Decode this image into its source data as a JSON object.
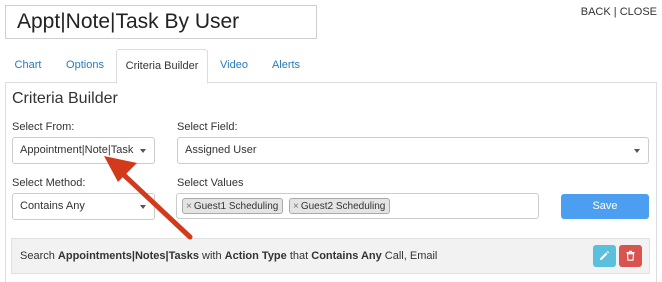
{
  "report_title": "Appt|Note|Task By User",
  "top_links": {
    "back": "BACK",
    "sep": " | ",
    "close": "CLOSE"
  },
  "tabs": [
    {
      "label": "Chart",
      "active": false
    },
    {
      "label": "Options",
      "active": false
    },
    {
      "label": "Criteria Builder",
      "active": true
    },
    {
      "label": "Video",
      "active": false
    },
    {
      "label": "Alerts",
      "active": false
    }
  ],
  "criteria": {
    "heading": "Criteria Builder",
    "select_from_label": "Select From:",
    "select_from_value": "Appointment|Note|Task",
    "select_field_label": "Select Field:",
    "select_field_value": "Assigned User",
    "select_method_label": "Select Method:",
    "select_method_value": "Contains Any",
    "select_values_label": "Select Values",
    "selected_values": [
      "Guest1 Scheduling",
      "Guest2 Scheduling"
    ],
    "chip_remove": "×",
    "save_label": "Save"
  },
  "summary": {
    "search": "Search ",
    "source": "Appointments|Notes|Tasks",
    "with": " with ",
    "field": "Action Type",
    "that": " that ",
    "method": "Contains Any",
    "values": " Call, Email"
  },
  "colors": {
    "link": "#2a7ab5",
    "save_button": "#4c9ff0",
    "edit_button": "#5bc0de",
    "delete_button": "#d9534f",
    "annotation_arrow": "#d33a1c"
  },
  "icons": {
    "edit": "pencil-icon",
    "delete": "trash-icon",
    "annotation": "red-arrow-annotation"
  }
}
